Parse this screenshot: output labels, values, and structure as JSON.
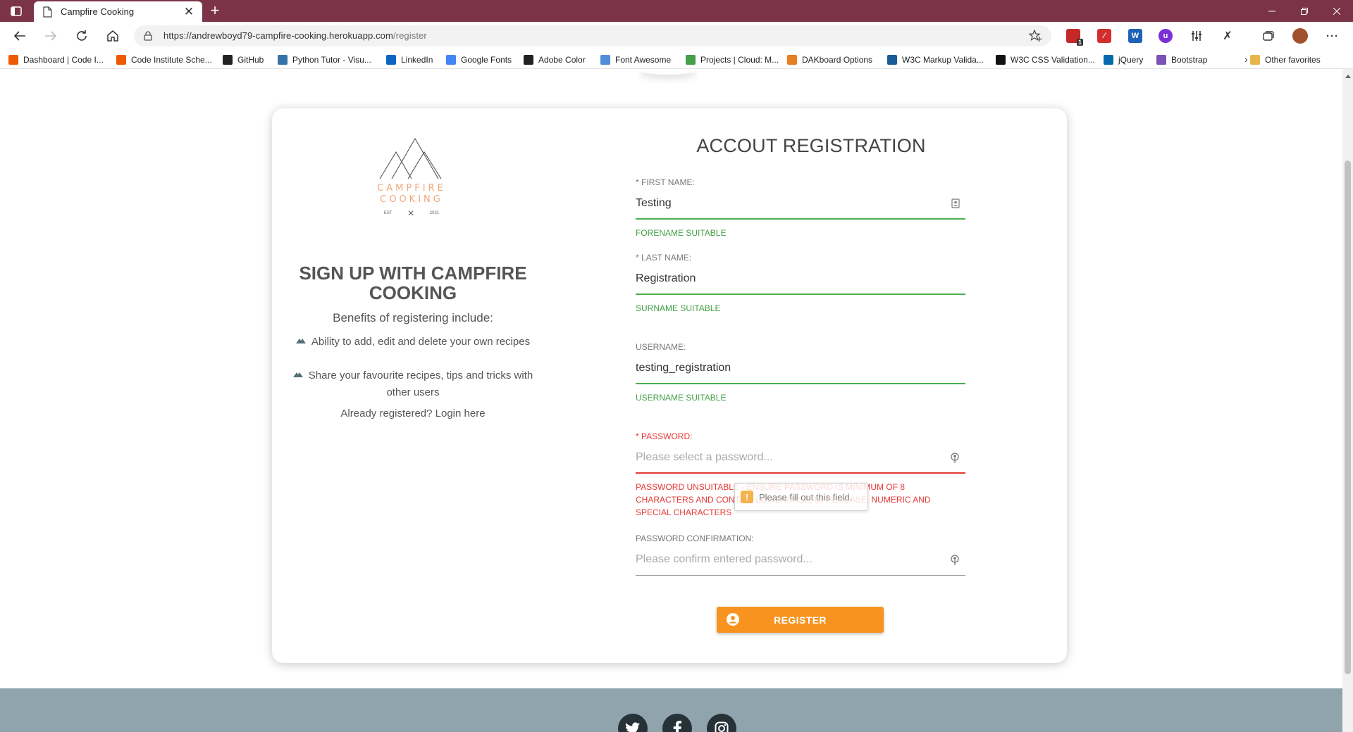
{
  "browser": {
    "tab_title": "Campfire Cooking",
    "url_prefix": "https://andrewboyd79-campfire-cooking.herokuapp.com",
    "url_path": "/register",
    "extension_badge": "1"
  },
  "bookmarks": [
    {
      "label": "Dashboard | Code I...",
      "icon_color": "#ef5a00"
    },
    {
      "label": "Code Institute Sche...",
      "icon_color": "#ef5a00"
    },
    {
      "label": "GitHub",
      "icon_color": "#222222"
    },
    {
      "label": "Python Tutor - Visu...",
      "icon_color": "#3572a5"
    },
    {
      "label": "LinkedIn",
      "icon_color": "#0a66c2"
    },
    {
      "label": "Google Fonts",
      "icon_color": "#4285f4"
    },
    {
      "label": "Adobe Color",
      "icon_color": "#222222"
    },
    {
      "label": "Font Awesome",
      "icon_color": "#528dd7"
    },
    {
      "label": "Projects | Cloud: M...",
      "icon_color": "#43a047"
    },
    {
      "label": "DAKboard Options",
      "icon_color": "#e67e22"
    },
    {
      "label": "W3C Markup Valida...",
      "icon_color": "#1a5a96"
    },
    {
      "label": "W3C CSS Validation...",
      "icon_color": "#111111"
    },
    {
      "label": "jQuery",
      "icon_color": "#0769ad"
    },
    {
      "label": "Bootstrap",
      "icon_color": "#7952b3"
    }
  ],
  "other_favorites": "Other favorites",
  "logo": {
    "line1": "CAMPFIRE",
    "line2": "COOKING",
    "est": "EST",
    "year": "2021"
  },
  "left": {
    "title": "SIGN UP WITH CAMPFIRE COOKING",
    "subtitle": "Benefits of registering include:",
    "benefits": [
      "Ability to add, edit and delete your own recipes",
      "Share your favourite recipes, tips and tricks with other users"
    ],
    "login_text": "Already registered? Login here"
  },
  "form": {
    "title": "ACCOUT REGISTRATION",
    "first_name": {
      "label": "FIRST NAME:",
      "value": "Testing",
      "message": "FORENAME SUITABLE"
    },
    "last_name": {
      "label": "LAST NAME:",
      "value": "Registration",
      "message": "SURNAME SUITABLE"
    },
    "username": {
      "label": "USERNAME:",
      "value": "testing_registration",
      "message": "USERNAME SUITABLE"
    },
    "password": {
      "label": "PASSWORD:",
      "placeholder": "Please select a password...",
      "message": "PASSWORD UNSUITABLE - ENSURE PASSWORD IS MINIMUM OF 8 CHARACTERS AND CONTAIN LOWERCASE, UPPERCASE, NUMERIC AND SPECIAL CHARACTERS"
    },
    "password_confirm": {
      "label": "PASSWORD CONFIRMATION:",
      "placeholder": "Please confirm entered password..."
    },
    "required_marker": "* ",
    "tooltip": "Please fill out this field.",
    "submit_label": "REGISTER"
  },
  "colors": {
    "titlebar": "#7b3447",
    "accent_orange": "#f7931e",
    "valid_green": "#43a047",
    "error_red": "#e53935",
    "footer": "#90a4ae",
    "logo_peach": "#f2a678"
  },
  "footer": {
    "social_icons": [
      "twitter-icon",
      "facebook-icon",
      "instagram-icon"
    ]
  }
}
